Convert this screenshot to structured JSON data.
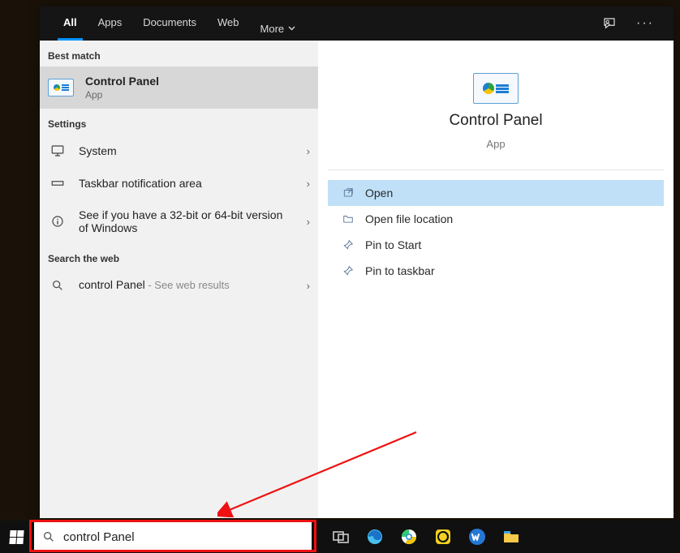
{
  "tabs": {
    "all": "All",
    "apps": "Apps",
    "documents": "Documents",
    "web": "Web",
    "more": "More"
  },
  "sections": {
    "best_match": "Best match",
    "settings": "Settings",
    "search_web": "Search the web"
  },
  "best": {
    "title": "Control Panel",
    "subtitle": "App"
  },
  "settings_items": [
    {
      "label": "System"
    },
    {
      "label": "Taskbar notification area"
    },
    {
      "label": "See if you have a 32-bit or 64-bit version of Windows"
    }
  ],
  "web_result": {
    "query": "control Panel",
    "suffix": " - See web results"
  },
  "preview": {
    "title": "Control Panel",
    "subtitle": "App"
  },
  "actions": {
    "open": "Open",
    "open_file_location": "Open file location",
    "pin_to_start": "Pin to Start",
    "pin_to_taskbar": "Pin to taskbar"
  },
  "search": {
    "value": "control Panel"
  }
}
